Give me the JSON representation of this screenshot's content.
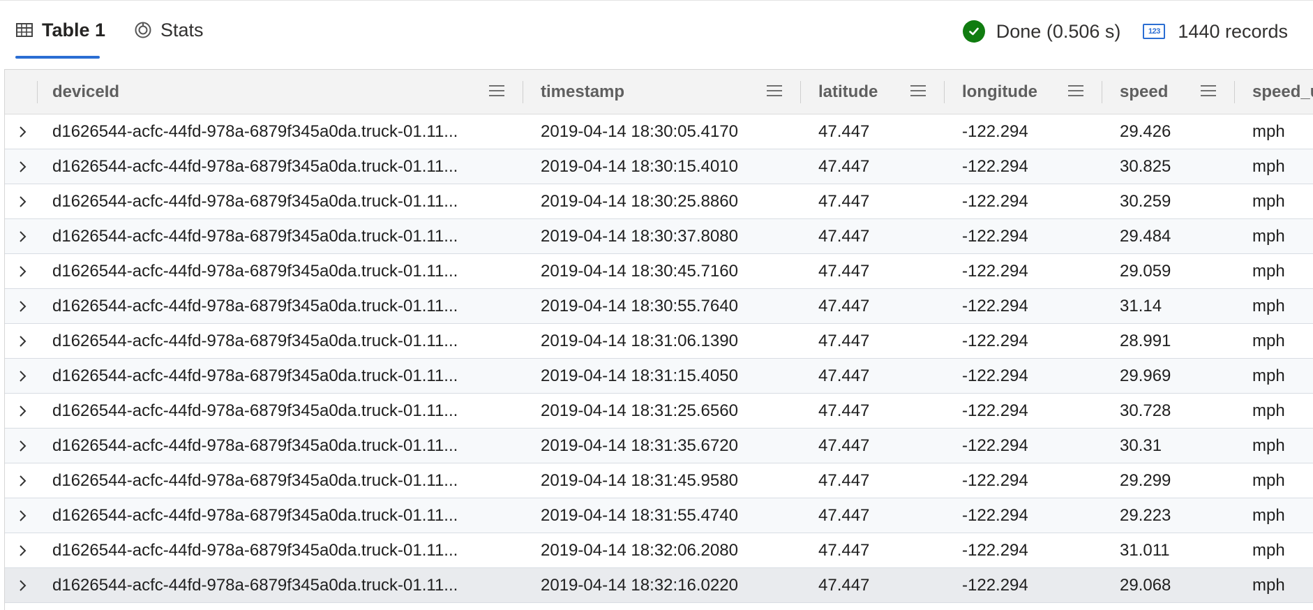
{
  "tabs": {
    "table_label": "Table 1",
    "stats_label": "Stats"
  },
  "status": {
    "done_text": "Done (0.506 s)",
    "records_icon_text": "123",
    "records_text": "1440 records"
  },
  "colors": {
    "accent": "#2b6ed3",
    "success": "#107c10"
  },
  "columns": [
    "deviceId",
    "timestamp",
    "latitude",
    "longitude",
    "speed",
    "speed_u"
  ],
  "rows": [
    [
      "d1626544-acfc-44fd-978a-6879f345a0da.truck-01.11...",
      "2019-04-14 18:30:05.4170",
      "47.447",
      "-122.294",
      "29.426",
      "mph"
    ],
    [
      "d1626544-acfc-44fd-978a-6879f345a0da.truck-01.11...",
      "2019-04-14 18:30:15.4010",
      "47.447",
      "-122.294",
      "30.825",
      "mph"
    ],
    [
      "d1626544-acfc-44fd-978a-6879f345a0da.truck-01.11...",
      "2019-04-14 18:30:25.8860",
      "47.447",
      "-122.294",
      "30.259",
      "mph"
    ],
    [
      "d1626544-acfc-44fd-978a-6879f345a0da.truck-01.11...",
      "2019-04-14 18:30:37.8080",
      "47.447",
      "-122.294",
      "29.484",
      "mph"
    ],
    [
      "d1626544-acfc-44fd-978a-6879f345a0da.truck-01.11...",
      "2019-04-14 18:30:45.7160",
      "47.447",
      "-122.294",
      "29.059",
      "mph"
    ],
    [
      "d1626544-acfc-44fd-978a-6879f345a0da.truck-01.11...",
      "2019-04-14 18:30:55.7640",
      "47.447",
      "-122.294",
      "31.14",
      "mph"
    ],
    [
      "d1626544-acfc-44fd-978a-6879f345a0da.truck-01.11...",
      "2019-04-14 18:31:06.1390",
      "47.447",
      "-122.294",
      "28.991",
      "mph"
    ],
    [
      "d1626544-acfc-44fd-978a-6879f345a0da.truck-01.11...",
      "2019-04-14 18:31:15.4050",
      "47.447",
      "-122.294",
      "29.969",
      "mph"
    ],
    [
      "d1626544-acfc-44fd-978a-6879f345a0da.truck-01.11...",
      "2019-04-14 18:31:25.6560",
      "47.447",
      "-122.294",
      "30.728",
      "mph"
    ],
    [
      "d1626544-acfc-44fd-978a-6879f345a0da.truck-01.11...",
      "2019-04-14 18:31:35.6720",
      "47.447",
      "-122.294",
      "30.31",
      "mph"
    ],
    [
      "d1626544-acfc-44fd-978a-6879f345a0da.truck-01.11...",
      "2019-04-14 18:31:45.9580",
      "47.447",
      "-122.294",
      "29.299",
      "mph"
    ],
    [
      "d1626544-acfc-44fd-978a-6879f345a0da.truck-01.11...",
      "2019-04-14 18:31:55.4740",
      "47.447",
      "-122.294",
      "29.223",
      "mph"
    ],
    [
      "d1626544-acfc-44fd-978a-6879f345a0da.truck-01.11...",
      "2019-04-14 18:32:06.2080",
      "47.447",
      "-122.294",
      "31.011",
      "mph"
    ],
    [
      "d1626544-acfc-44fd-978a-6879f345a0da.truck-01.11...",
      "2019-04-14 18:32:16.0220",
      "47.447",
      "-122.294",
      "29.068",
      "mph"
    ]
  ]
}
